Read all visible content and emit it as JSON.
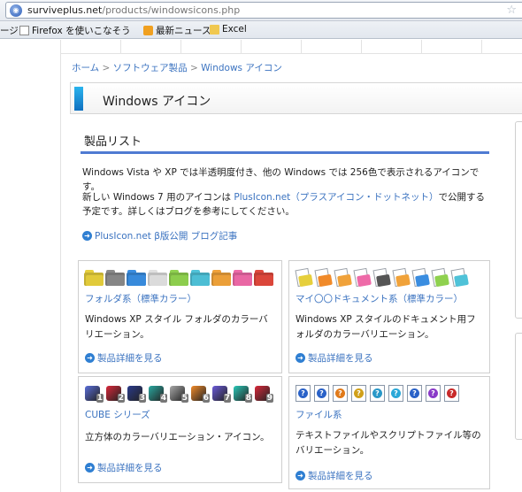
{
  "browser": {
    "url_host": "surviveplus.net",
    "url_path": "/products/windowsicons.php",
    "bookmarks": [
      {
        "label": "ージ"
      },
      {
        "label": "Firefox を使いこなそう"
      },
      {
        "label": "最新ニュース"
      },
      {
        "label": "Excel"
      }
    ]
  },
  "breadcrumb": {
    "home": "ホーム",
    "sep1": " > ",
    "software": "ソフトウェア製品",
    "sep2": " > ",
    "current": "Windows アイコン"
  },
  "page_title": "Windows アイコン",
  "section_title": "製品リスト",
  "para1": "Windows Vista や XP では半透明度付き、他の Windows では 256色で表示されるアイコンです。",
  "para2": {
    "before": "新しい Windows 7 用のアイコンは ",
    "link": "PlusIcon.net（プラスアイコン・ドットネット）",
    "after": "で公開する予定です。詳しくはブログを参考にしてください。"
  },
  "blog_link": "PlusIcon.net β版公開 ブログ記事",
  "products": [
    {
      "name": "フォルダ系（標準カラー）",
      "desc": "Windows XP スタイル フォルダのカラーバリエーション。",
      "link": "製品詳細を見る"
    },
    {
      "name": "マイ〇〇ドキュメント系（標準カラー）",
      "desc": "Windows XP スタイルのドキュメント用フォルダのカラーバリエーション。",
      "link": "製品詳細を見る"
    },
    {
      "name": "CUBE シリーズ",
      "desc": "立方体のカラーバリエーション・アイコン。",
      "link": "製品詳細を見る"
    },
    {
      "name": "ファイル系",
      "desc": "テキストファイルやスクリプトファイル等のバリエーション。",
      "link": "製品詳細を見る"
    }
  ],
  "folder_colors": [
    "#e6cf3c",
    "#8a8a8a",
    "#3a8de0",
    "#e0e0e0",
    "#8fd14f",
    "#4fc2d8",
    "#f0a23a",
    "#ee6aa8",
    "#e0483c"
  ],
  "doc_colors": [
    "#e6cf3c",
    "#f08a2a",
    "#f0a23a",
    "#ee6aa8",
    "#555555",
    "#f0a23a",
    "#3a8de0",
    "#8fd14f",
    "#4fc2d8"
  ],
  "cube_items": [
    {
      "n": "1",
      "color": "#5a6ed8"
    },
    {
      "n": "2",
      "color": "#d8283a"
    },
    {
      "n": "3",
      "color": "#2a3a8a"
    },
    {
      "n": "4",
      "color": "#2aa8a0"
    },
    {
      "n": "5",
      "color": "#a8a8a8"
    },
    {
      "n": "6",
      "color": "#f08a2a"
    },
    {
      "n": "7",
      "color": "#6a5ad8"
    },
    {
      "n": "8",
      "color": "#2ac8b8"
    },
    {
      "n": "9",
      "color": "#d8283a"
    }
  ],
  "file_colors": [
    "#2a62c8",
    "#2a62c8",
    "#e07a1a",
    "#d0a01a",
    "#2a98c8",
    "#2aa8d8",
    "#2a62c8",
    "#8a3ac8",
    "#c82a2a"
  ]
}
